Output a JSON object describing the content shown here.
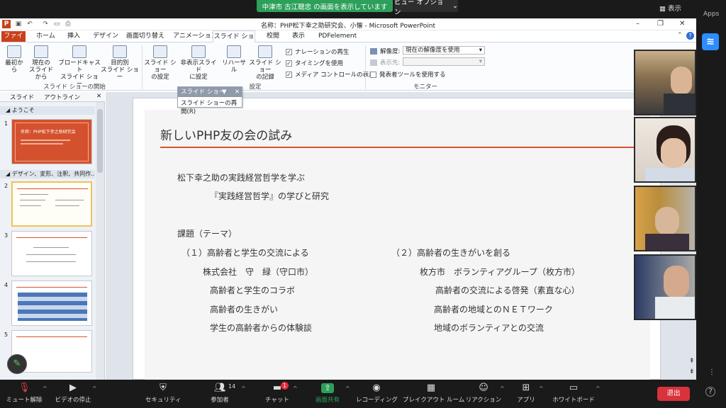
{
  "zoom": {
    "share_banner": "中津市 古江聰忠 の画面を表示しています",
    "view_options": "ビュー オプション",
    "display_label": "表示",
    "apps_label": "Apps",
    "toolbar": {
      "mute": "ミュート解除",
      "video": "ビデオの停止",
      "security": "セキュリティ",
      "participants": "参加者",
      "participants_count": "14",
      "chat": "チャット",
      "chat_badge": "1",
      "share": "画面共有",
      "record": "レコーディング",
      "breakout": "ブレイクアウト ルーム",
      "reactions": "リアクション",
      "apps": "アプリ",
      "whiteboard": "ホワイトボード",
      "end": "退出"
    }
  },
  "ppt": {
    "title": "名称：PHP松下幸之助研究会、小懐 - Microsoft PowerPoint",
    "tabs": {
      "file": "ファイル",
      "home": "ホーム",
      "insert": "挿入",
      "design": "デザイン",
      "transitions": "画面切り替え",
      "animations": "アニメーション",
      "slideshow": "スライド ショー",
      "review": "校閲",
      "view": "表示",
      "pdf": "PDFelement"
    },
    "ribbon": {
      "from_start": "最初から",
      "from_current": "現在の\nスライドから",
      "broadcast": "ブロードキャスト\nスライド ショー",
      "custom": "目的別\nスライド ショー",
      "group_start": "スライド ショーの開始",
      "setup": "スライド ショー\nの設定",
      "hide": "非表示スライド\nに設定",
      "rehearse": "リハーサル",
      "record": "スライド ショー\nの記録",
      "narration": "ナレーションの再生",
      "timing": "タイミングを使用",
      "media": "メディア コントロールの表示",
      "group_setup": "設定",
      "resolution_label": "解像度:",
      "resolution_value": "現在の解像度を使用",
      "show_on_label": "表示先:",
      "presenter": "発表者ツールを使用する",
      "group_monitor": "モニター"
    },
    "panel": {
      "tab_slides": "スライド",
      "tab_outline": "アウトライン",
      "section1": "ようこそ",
      "section2": "デザイン、変形、注釈、共同作...",
      "thumb1_title": "名称：PHP松下幸之助研究会"
    },
    "popup": {
      "header": "スライド ショー",
      "item": "スライド ショーの再開(R)"
    },
    "slide": {
      "title": "新しいPHP友の会の試み",
      "line1": "松下幸之助の実践経営哲学を学ぶ",
      "line2": "『実践経営哲学』の学びと研究",
      "theme": "課題（テーマ）",
      "left": [
        "（１）高齢者と学生の交流による",
        "株式会社　守　緑（守口市）",
        "高齢者と学生のコラボ",
        "高齢者の生きがい",
        "学生の高齢者からの体験談"
      ],
      "right": [
        "（２）高齢者の生きがいを創る",
        "枚方市　ボランティアグループ（枚方市）",
        "高齢者の交流による啓発（素直な心）",
        "高齢者の地域とのＮＥＴワーク",
        "地域のボランティアとの交流"
      ]
    }
  }
}
